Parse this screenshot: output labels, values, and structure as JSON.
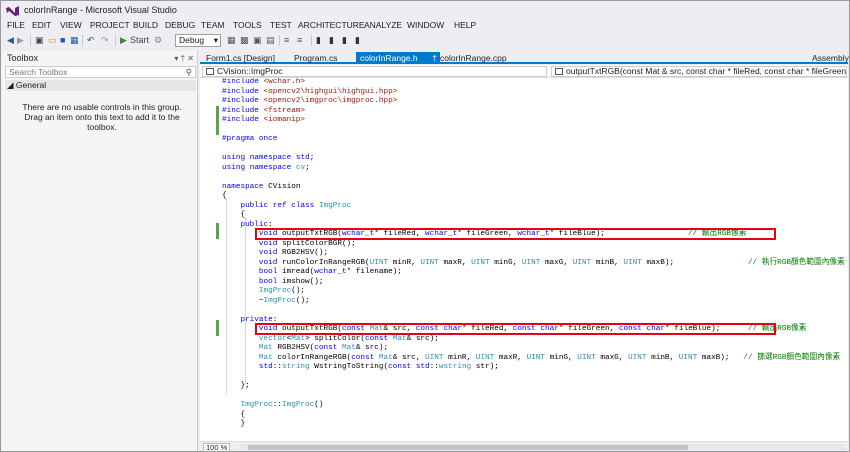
{
  "window": {
    "title": "colorInRange - Microsoft Visual Studio"
  },
  "menu": [
    "FILE",
    "EDIT",
    "VIEW",
    "PROJECT",
    "BUILD",
    "DEBUG",
    "TEAM",
    "TOOLS",
    "TEST",
    "ARCHITECTURE",
    "ANALYZE",
    "WINDOW",
    "HELP"
  ],
  "toolbar": {
    "start_label": "Start",
    "config": "Debug"
  },
  "toolbox": {
    "title": "Toolbox",
    "search_placeholder": "Search Toolbox",
    "group": "General",
    "empty_message": "There are no usable controls in this group. Drag an item onto this text to add it to the toolbox."
  },
  "tabs": [
    "Form1.cs [Design]",
    "Program.cs",
    "colorInRange.h",
    "colorInRange.cpp",
    "AssemblyIn"
  ],
  "active_tab": "colorInRange.h",
  "navbar": {
    "scope": "CVision::ImgProc",
    "member": "outputTxtRGB(const Mat & src, const char * fileRed, const char * fileGreen, const char"
  },
  "status": {
    "zoom": "100 %"
  },
  "colors": {
    "accent": "#007acc",
    "highlight_box": "#e60012",
    "change_bar": "#57a64a"
  },
  "code": [
    "#include <wchar.h>",
    "#include <opencv2\\highgui\\highgui.hpp>",
    "#include <opencv2\\imgproc\\imgproc.hpp>",
    "#include <fstream>",
    "#include <iomanip>",
    "",
    "#pragma once",
    "",
    "using namespace std;",
    "using namespace cv;",
    "",
    "namespace CVision",
    "{",
    "    public ref class ImgProc",
    "    {",
    "    public:",
    "        void outputTxtRGB(wchar_t* fileRed, wchar_t* fileGreen, wchar_t* fileBlue);                  // 輸出RGB像素",
    "        void splitColorBGR();",
    "        void RGB2HSV();",
    "        void runColorInRangeRGB(UINT minR, UINT maxR, UINT minG, UINT maxG, UINT minB, UINT maxB);                // 執行RGB顏色範圍內像素",
    "        bool imread(wchar_t* filename);",
    "        bool imshow();",
    "        ImgProc();",
    "        ~ImgProc();",
    "",
    "    private:",
    "        void outputTxtRGB(const Mat& src, const char* fileRed, const char* fileGreen, const char* fileBlue);      // 輸出RGB像素",
    "        vector<Mat> splitColor(const Mat& src);",
    "        Mat RGB2HSV(const Mat& src);",
    "        Mat colorInRangeRGB(const Mat& src, UINT minR, UINT maxR, UINT minG, UINT maxG, UINT minB, UINT maxB);   // 篩選RGB顏色範圍內像素",
    "        std::string WstringToString(const std::wstring str);",
    "",
    "    };",
    "",
    "    ImgProc::ImgProc()",
    "    {",
    "    }"
  ]
}
